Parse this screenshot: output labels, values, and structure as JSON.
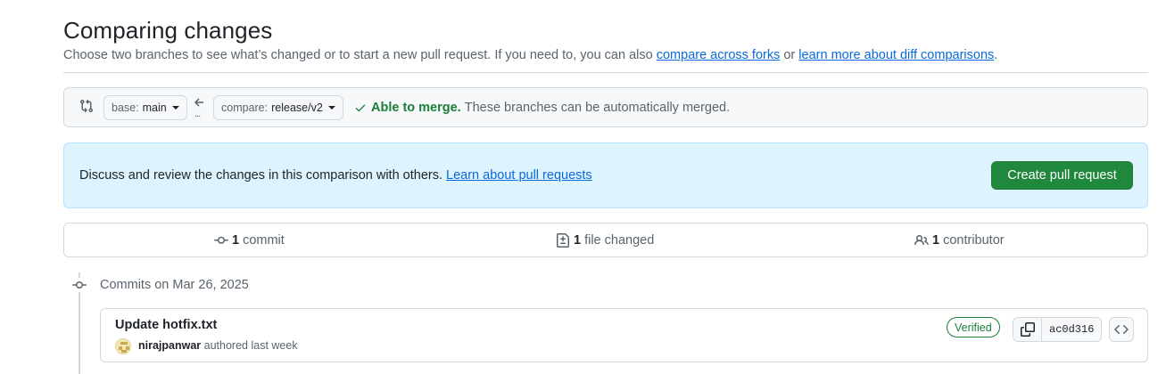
{
  "page": {
    "title": "Comparing changes",
    "subtitle_prefix": "Choose two branches to see what’s changed or to start a new pull request. If you need to, you can also ",
    "compare_forks_link": "compare across forks",
    "subtitle_or": " or ",
    "learn_diff_link": "learn more about diff comparisons",
    "subtitle_end": "."
  },
  "range": {
    "base_label": "base:",
    "base_value": "main",
    "compare_label": "compare:",
    "compare_value": "release/v2",
    "dots": "...",
    "merge_status": "Able to merge.",
    "merge_message": "These branches can be automatically merged."
  },
  "blankslate": {
    "text": "Discuss and review the changes in this comparison with others. ",
    "learn_link": "Learn about pull requests",
    "create_button": "Create pull request"
  },
  "stats": {
    "commits_count": "1",
    "commits_label": "commit",
    "files_count": "1",
    "files_label": "file changed",
    "contributors_count": "1",
    "contributors_label": "contributor"
  },
  "commits": {
    "date_heading": "Commits on Mar 26, 2025",
    "items": [
      {
        "title": "Update hotfix.txt",
        "author": "nirajpanwar",
        "meta": " authored last week",
        "verified": "Verified",
        "sha": "ac0d316"
      }
    ]
  },
  "colors": {
    "accent_link": "#0969da",
    "success": "#1a7f37",
    "primary_button": "#1f883d",
    "info_bg": "#ddf4ff"
  }
}
